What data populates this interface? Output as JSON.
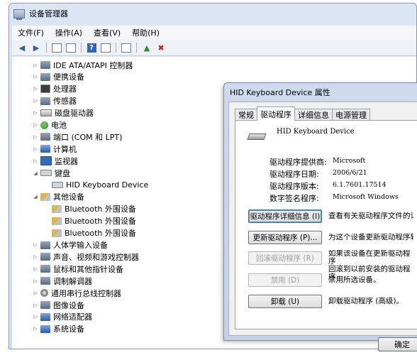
{
  "window": {
    "title": "设备管理器",
    "menu": [
      "文件(F)",
      "操作(A)",
      "查看(V)",
      "帮助(H)"
    ]
  },
  "toolbar_icons": [
    "back-arrow-icon",
    "forward-arrow-icon",
    "show-hide-icon",
    "properties-icon",
    "help-icon",
    "view-icon",
    "update-driver-icon",
    "uninstall-icon"
  ],
  "tree": [
    {
      "label": "IDE ATA/ATAPI 控制器",
      "level": 0,
      "expander": "collapsed",
      "icon": "dev"
    },
    {
      "label": "便携设备",
      "level": 0,
      "expander": "collapsed",
      "icon": "dev"
    },
    {
      "label": "处理器",
      "level": 0,
      "expander": "collapsed",
      "icon": "chip"
    },
    {
      "label": "传感器",
      "level": 0,
      "expander": "collapsed",
      "icon": "dev"
    },
    {
      "label": "磁盘驱动器",
      "level": 0,
      "expander": "collapsed",
      "icon": "disk"
    },
    {
      "label": "电池",
      "level": 0,
      "expander": "collapsed",
      "icon": "green"
    },
    {
      "label": "端口 (COM 和 LPT)",
      "level": 0,
      "expander": "collapsed",
      "icon": "dev"
    },
    {
      "label": "计算机",
      "level": 0,
      "expander": "collapsed",
      "icon": "pc"
    },
    {
      "label": "监视器",
      "level": 0,
      "expander": "collapsed",
      "icon": "mon"
    },
    {
      "label": "键盘",
      "level": 0,
      "expander": "expanded",
      "icon": "kbd"
    },
    {
      "label": "HID Keyboard Device",
      "level": 1,
      "expander": "none",
      "icon": "kbd"
    },
    {
      "label": "其他设备",
      "level": 0,
      "expander": "expanded",
      "icon": "warn"
    },
    {
      "label": "Bluetooth 外围设备",
      "level": 1,
      "expander": "none",
      "icon": "warn"
    },
    {
      "label": "Bluetooth 外围设备",
      "level": 1,
      "expander": "none",
      "icon": "warn"
    },
    {
      "label": "Bluetooth 外围设备",
      "level": 1,
      "expander": "none",
      "icon": "warn"
    },
    {
      "label": "人体学输入设备",
      "level": 0,
      "expander": "collapsed",
      "icon": "dev"
    },
    {
      "label": "声音、视频和游戏控制器",
      "level": 0,
      "expander": "collapsed",
      "icon": "dev"
    },
    {
      "label": "鼠标和其他指针设备",
      "level": 0,
      "expander": "collapsed",
      "icon": "dev"
    },
    {
      "label": "调制解调器",
      "level": 0,
      "expander": "collapsed",
      "icon": "dev"
    },
    {
      "label": "通用串行总线控制器",
      "level": 0,
      "expander": "collapsed",
      "icon": "gear"
    },
    {
      "label": "图像设备",
      "level": 0,
      "expander": "collapsed",
      "icon": "dev"
    },
    {
      "label": "网络适配器",
      "level": 0,
      "expander": "collapsed",
      "icon": "pc"
    },
    {
      "label": "系统设备",
      "level": 0,
      "expander": "collapsed",
      "icon": "pc"
    }
  ],
  "dialog": {
    "title": "HID Keyboard Device 属性",
    "tabs": [
      "常规",
      "驱动程序",
      "详细信息",
      "电源管理"
    ],
    "selected_tab": "驱动程序",
    "device_name": "HID Keyboard Device",
    "info": [
      {
        "label": "驱动程序提供商:",
        "value": "Microsoft"
      },
      {
        "label": "驱动程序日期:",
        "value": "2006/6/21"
      },
      {
        "label": "驱动程序版本:",
        "value": "6.1.7601.17514"
      },
      {
        "label": "数字签名程序:",
        "value": "Microsoft Windows"
      }
    ],
    "buttons": [
      {
        "label": "驱动程序详细信息 (I)",
        "desc": "查看有关驱动程序文件的详",
        "enabled": true
      },
      {
        "label": "更新驱动程序 (P)...",
        "desc": "为这个设备更新驱动程序软",
        "enabled": true
      },
      {
        "label": "回滚驱动程序 (R)",
        "desc": "如果该设备在更新驱动程序\n回滚到以前安装的驱动程序",
        "enabled": false
      },
      {
        "label": "禁用 (D)",
        "desc": "禁用所选设备。",
        "enabled": false
      },
      {
        "label": "卸载 (U)",
        "desc": "卸载驱动程序 (高级)。",
        "enabled": true
      }
    ],
    "ok_label": "确定"
  }
}
